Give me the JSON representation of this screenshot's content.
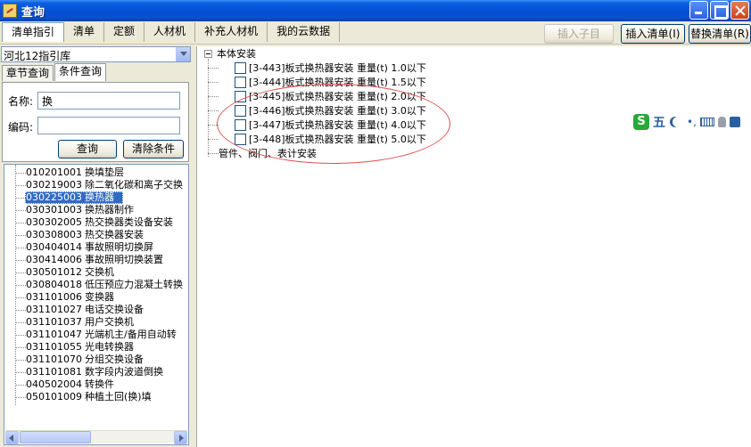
{
  "window": {
    "title": "查询"
  },
  "tabs": [
    "清单指引",
    "清单",
    "定额",
    "人材机",
    "补充人材机",
    "我的云数据"
  ],
  "toolbar": {
    "insert_child": "插入子目",
    "insert_list": "插入清单(I)",
    "replace_list": "替换清单(R)"
  },
  "left": {
    "library": "河北12指引库",
    "subtabs": [
      "章节查询",
      "条件查询"
    ],
    "form": {
      "name_label": "名称:",
      "name_value": "换",
      "code_label": "编码:",
      "code_value": "",
      "query_btn": "查询",
      "clear_btn": "清除条件"
    },
    "items": [
      {
        "code": "010201001",
        "name": "换填垫层"
      },
      {
        "code": "030219003",
        "name": "除二氧化碳和离子交换"
      },
      {
        "code": "030225003",
        "name": "换热器"
      },
      {
        "code": "030301003",
        "name": "换热器制作"
      },
      {
        "code": "030302005",
        "name": "热交换器类设备安装"
      },
      {
        "code": "030308003",
        "name": "热交换器安装"
      },
      {
        "code": "030404014",
        "name": "事故照明切换屏"
      },
      {
        "code": "030414006",
        "name": "事故照明切换装置"
      },
      {
        "code": "030501012",
        "name": "交换机"
      },
      {
        "code": "030804018",
        "name": "低压预应力混凝土转换"
      },
      {
        "code": "031101006",
        "name": "变换器"
      },
      {
        "code": "031101027",
        "name": "电话交换设备"
      },
      {
        "code": "031101037",
        "name": "用户交换机"
      },
      {
        "code": "031101047",
        "name": "光端机主/备用自动转"
      },
      {
        "code": "031101055",
        "name": "光电转换器"
      },
      {
        "code": "031101070",
        "name": "分组交换设备"
      },
      {
        "code": "031101081",
        "name": "数字段内波道倒换"
      },
      {
        "code": "040502004",
        "name": "转换件"
      },
      {
        "code": "050101009",
        "name": "种植土回(换)填"
      }
    ]
  },
  "right": {
    "group1": "本体安装",
    "group2": "管件、阀门、表计安装",
    "entries": [
      "[3-443]板式换热器安装 重量(t) 1.0以下",
      "[3-444]板式换热器安装 重量(t) 1.5以下",
      "[3-445]板式换热器安装 重量(t) 2.0以下",
      "[3-446]板式换热器安装 重量(t) 3.0以下",
      "[3-447]板式换热器安装 重量(t) 4.0以下",
      "[3-448]板式换热器安装 重量(t) 5.0以下"
    ]
  },
  "ime": {
    "brand": "S",
    "mode": "五"
  }
}
